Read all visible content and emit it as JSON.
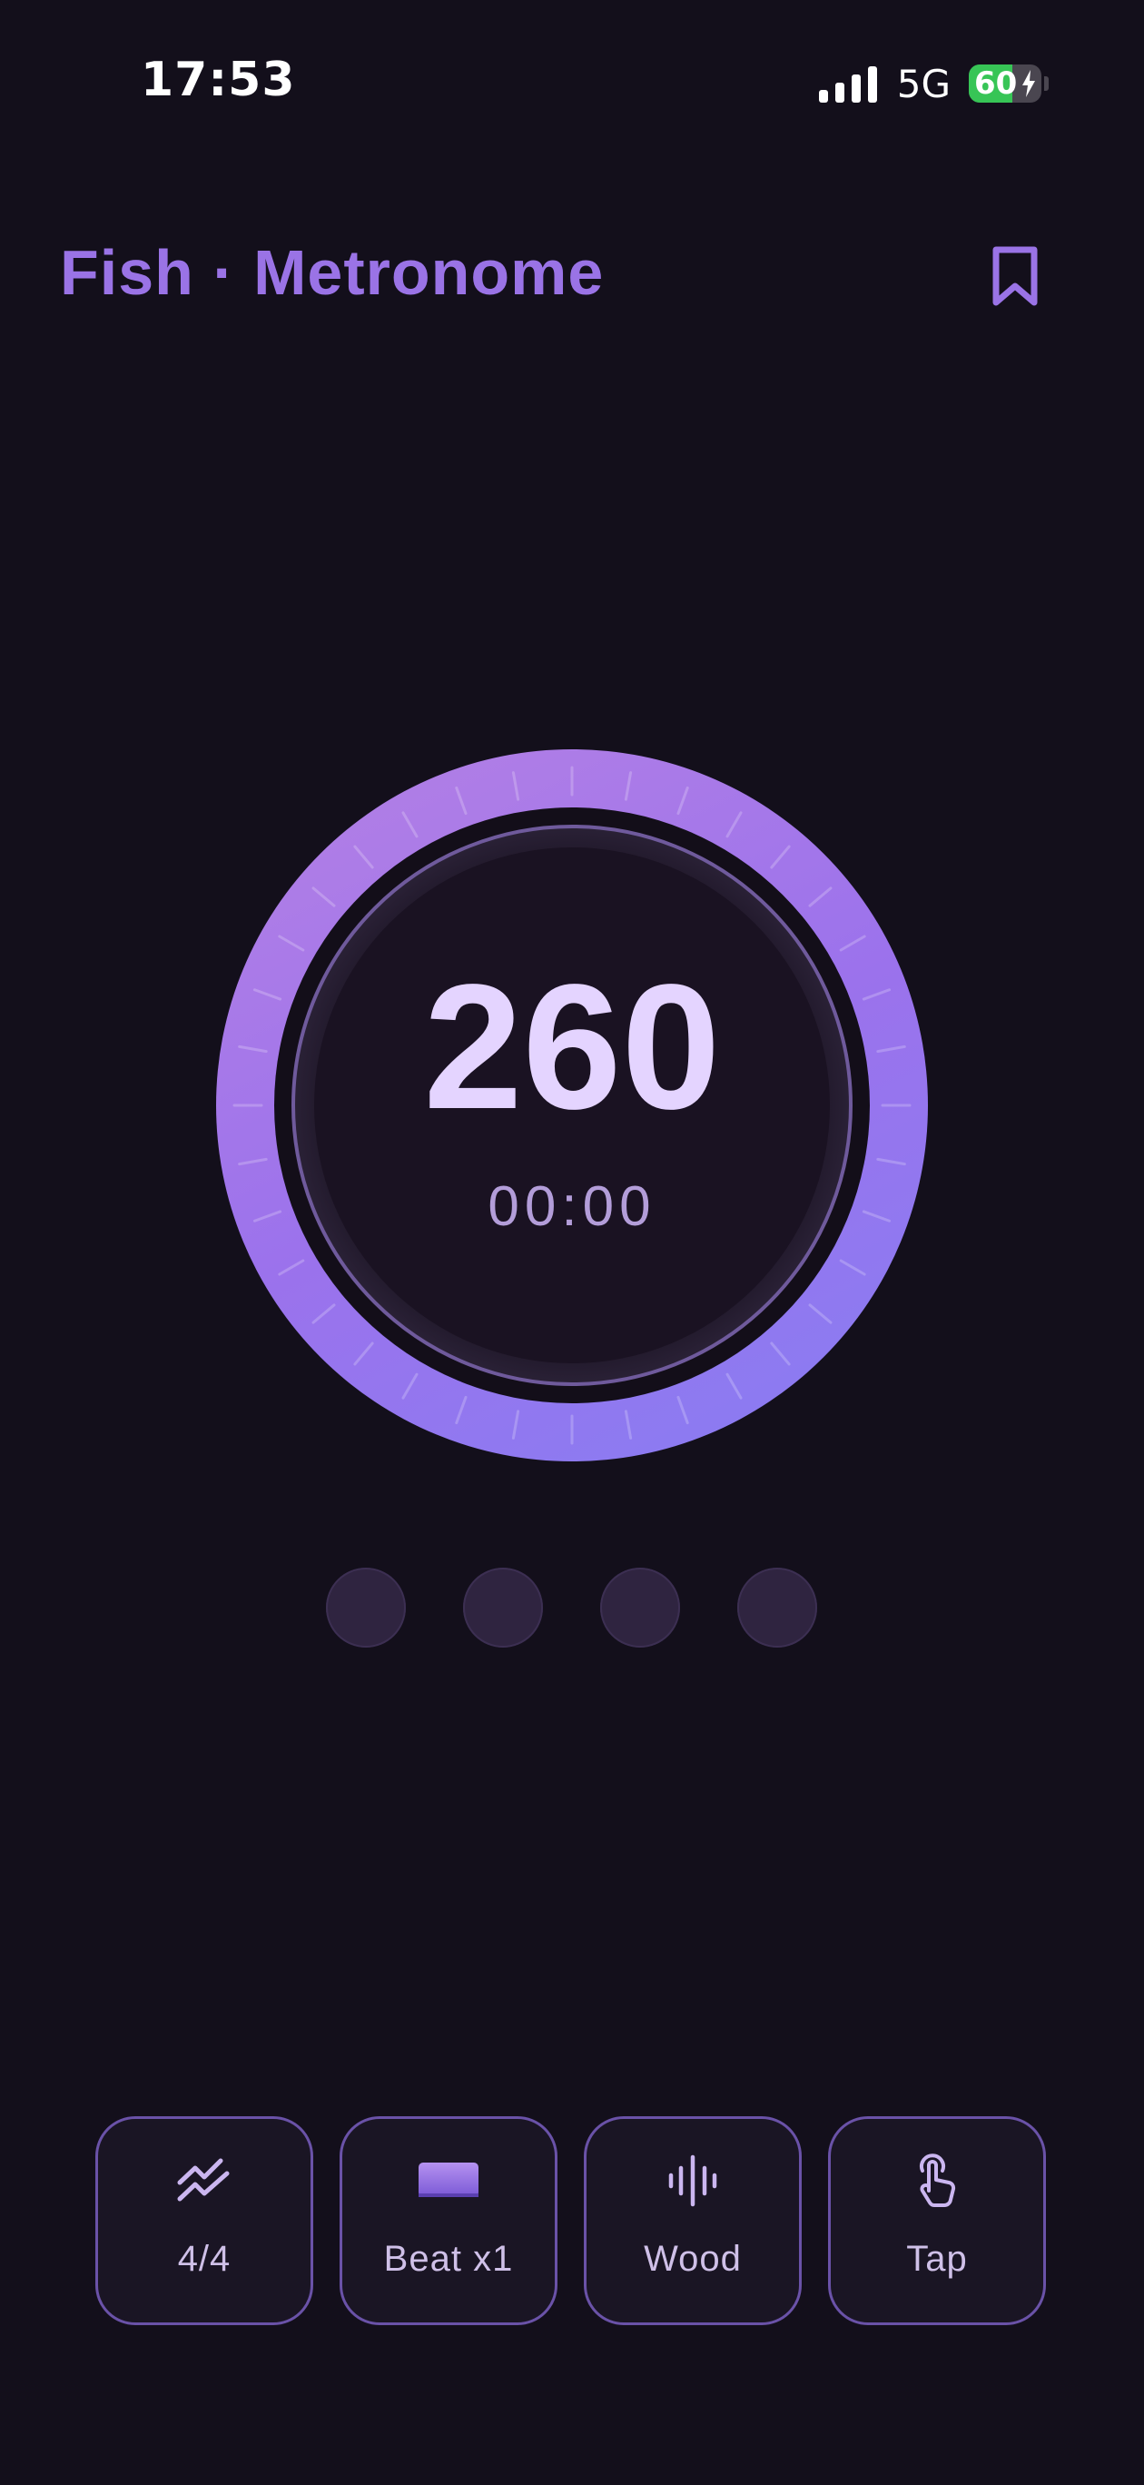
{
  "status": {
    "time": "17:53",
    "network": "5G",
    "battery": "60",
    "battery_level": 0.6
  },
  "header": {
    "title": "Fish · Metronome",
    "bookmark_icon": "bookmark-icon"
  },
  "dial": {
    "bpm": "260",
    "timer": "00:00"
  },
  "beats": {
    "count": 4,
    "active": 0
  },
  "controls": [
    {
      "label": "4/4",
      "icon": "time-signature-icon"
    },
    {
      "label": "Beat x1",
      "icon": "accent-pad-icon"
    },
    {
      "label": "Wood",
      "icon": "sound-wave-icon"
    },
    {
      "label": "Tap",
      "icon": "tap-hand-icon"
    }
  ],
  "colors": {
    "background": "#130f1b",
    "accent": "#9a73e6",
    "ring_start": "#a87ae8",
    "ring_end": "#8a78f0",
    "bpm_text": "#e4d4ff",
    "dot_inactive": "#2f2440",
    "button_border": "#6a52a8"
  }
}
